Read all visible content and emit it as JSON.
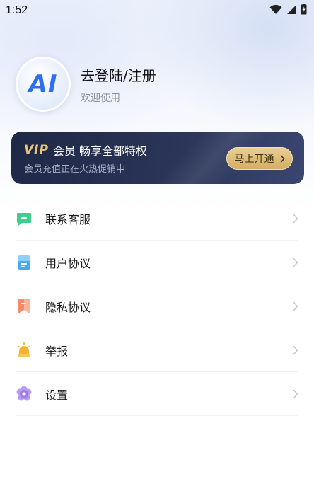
{
  "status": {
    "time": "1:52"
  },
  "profile": {
    "avatar_text": "AI",
    "login_title": "去登陆/注册",
    "login_sub": "欢迎使用"
  },
  "vip": {
    "logo": "VIP",
    "title": "会员 畅享全部特权",
    "subtitle": "会员充值正在火热促销中",
    "button_label": "马上开通",
    "colors": {
      "card": "#1e2847",
      "gold": "#e8c47c"
    }
  },
  "menu": [
    {
      "label": "联系客服",
      "icon": "chat-bubble-icon",
      "color": "#3ecf8e"
    },
    {
      "label": "用户协议",
      "icon": "document-icon",
      "color": "#4aa8f0"
    },
    {
      "label": "隐私协议",
      "icon": "bookmark-icon",
      "color": "#f58a6a"
    },
    {
      "label": "举报",
      "icon": "alarm-light-icon",
      "color": "#f5b52a"
    },
    {
      "label": "设置",
      "icon": "gear-flower-icon",
      "color": "#a07be8"
    }
  ]
}
